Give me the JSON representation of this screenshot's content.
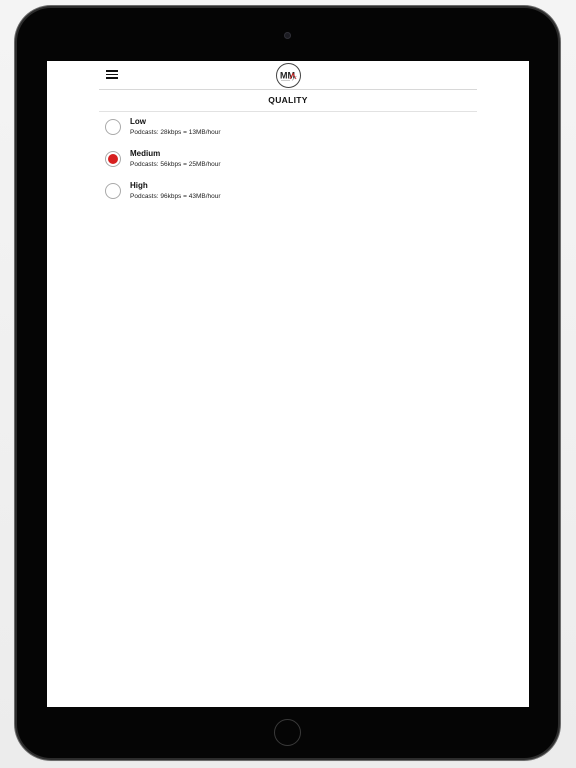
{
  "app": {
    "logo_text": "MM"
  },
  "page": {
    "title": "QUALITY"
  },
  "options": [
    {
      "label": "Low",
      "description": "Podcasts: 28kbps = 13MB/hour",
      "selected": false
    },
    {
      "label": "Medium",
      "description": "Podcasts: 56kbps = 25MB/hour",
      "selected": true
    },
    {
      "label": "High",
      "description": "Podcasts: 96kbps = 43MB/hour",
      "selected": false
    }
  ],
  "colors": {
    "accent": "#d71f1f",
    "device_bezel": "#050505",
    "screen_background": "#ffffff"
  },
  "icons": {
    "menu": "hamburger-menu-icon",
    "camera": "front-camera",
    "home": "home-button"
  }
}
